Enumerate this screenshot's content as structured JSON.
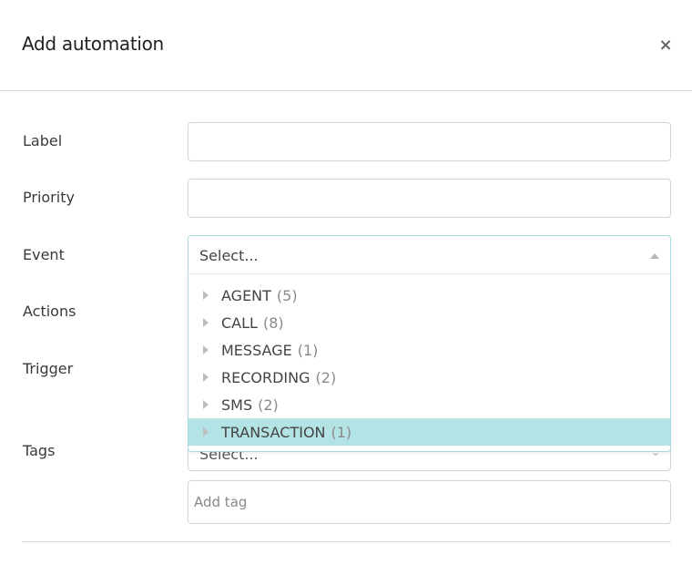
{
  "dialog": {
    "title": "Add automation",
    "close_symbol": "×"
  },
  "form": {
    "label": {
      "label": "Label",
      "value": ""
    },
    "priority": {
      "label": "Priority",
      "value": ""
    },
    "event": {
      "label": "Event",
      "placeholder": "Select...",
      "options": [
        {
          "name": "AGENT",
          "count": "(5)"
        },
        {
          "name": "CALL",
          "count": "(8)"
        },
        {
          "name": "MESSAGE",
          "count": "(1)"
        },
        {
          "name": "RECORDING",
          "count": "(2)"
        },
        {
          "name": "SMS",
          "count": "(2)"
        },
        {
          "name": "TRANSACTION",
          "count": "(1)"
        }
      ],
      "highlighted_option": "TRANSACTION"
    },
    "actions": {
      "label": "Actions"
    },
    "trigger": {
      "label": "Trigger"
    },
    "tags": {
      "label": "Tags",
      "select_placeholder": "Select...",
      "input_placeholder": "Add tag"
    }
  },
  "colors": {
    "highlight": "#b3e3e4",
    "focus_border": "#a9dbe0"
  }
}
